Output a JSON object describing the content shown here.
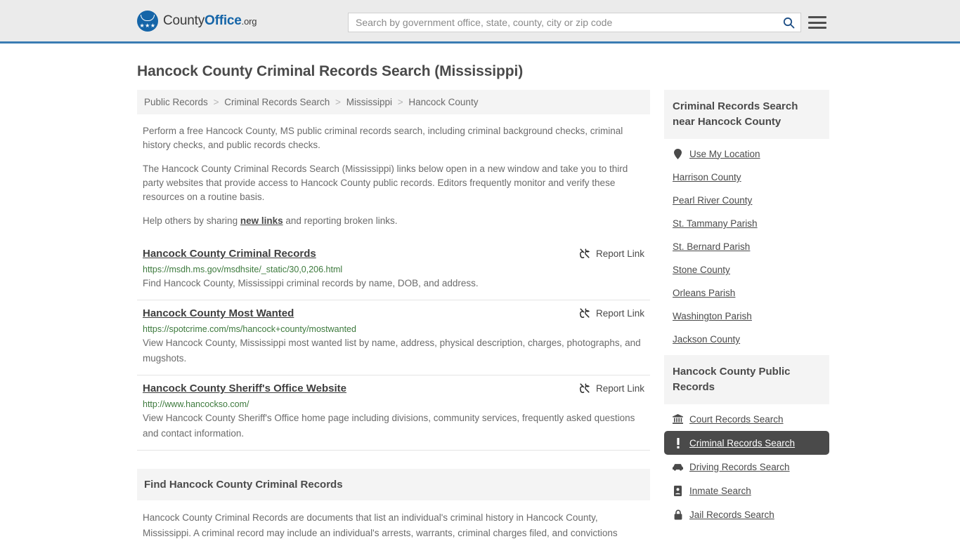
{
  "header": {
    "brand": {
      "part1": "County",
      "part2": "Office",
      "tld": ".org",
      "stars": "★★★"
    },
    "search": {
      "placeholder": "Search by government office, state, county, city or zip code",
      "value": "",
      "search_icon": "search-icon",
      "menu_icon": "hamburger-menu-icon"
    }
  },
  "page": {
    "title": "Hancock County Criminal Records Search (Mississippi)"
  },
  "breadcrumb": {
    "separator": ">",
    "items": [
      {
        "label": "Public Records"
      },
      {
        "label": "Criminal Records Search"
      },
      {
        "label": "Mississippi"
      },
      {
        "label": "Hancock County"
      }
    ]
  },
  "intro": {
    "p1": "Perform a free Hancock County, MS public criminal records search, including criminal background checks, criminal history checks, and public records checks.",
    "p2": "The Hancock County Criminal Records Search (Mississippi) links below open in a new window and take you to third party websites that provide access to Hancock County public records. Editors frequently monitor and verify these resources on a routine basis.",
    "p3_before": "Help others by sharing ",
    "p3_link": "new links",
    "p3_after": " and reporting broken links."
  },
  "report_link_label": "Report Link",
  "report_link_icon": "broken-link-icon",
  "links": [
    {
      "title": "Hancock County Criminal Records",
      "url": "https://msdh.ms.gov/msdhsite/_static/30,0,206.html",
      "description": "Find Hancock County, Mississippi criminal records by name, DOB, and address."
    },
    {
      "title": "Hancock County Most Wanted",
      "url": "https://spotcrime.com/ms/hancock+county/mostwanted",
      "description": "View Hancock County, Mississippi most wanted list by name, address, physical description, charges, photographs, and mugshots."
    },
    {
      "title": "Hancock County Sheriff's Office Website",
      "url": "http://www.hancockso.com/",
      "description": "View Hancock County Sheriff's Office home page including divisions, community services, frequently asked questions and contact information."
    }
  ],
  "find_section": {
    "heading": "Find Hancock County Criminal Records",
    "body": "Hancock County Criminal Records are documents that list an individual's criminal history in Hancock County, Mississippi. A criminal record may include an individual's arrests, warrants, criminal charges filed, and convictions"
  },
  "sidebar": {
    "nearby": {
      "heading": "Criminal Records Search near Hancock County",
      "use_my_location": {
        "label": "Use My Location",
        "icon": "map-pin-icon"
      },
      "items": [
        {
          "label": "Harrison County"
        },
        {
          "label": "Pearl River County"
        },
        {
          "label": "St. Tammany Parish"
        },
        {
          "label": "St. Bernard Parish"
        },
        {
          "label": "Stone County"
        },
        {
          "label": "Orleans Parish"
        },
        {
          "label": "Washington Parish"
        },
        {
          "label": "Jackson County"
        }
      ]
    },
    "public_records": {
      "heading": "Hancock County Public Records",
      "items": [
        {
          "label": "Court Records Search",
          "icon": "courthouse-icon",
          "active": false
        },
        {
          "label": "Criminal Records Search",
          "icon": "exclamation-icon",
          "active": true
        },
        {
          "label": "Driving Records Search",
          "icon": "car-icon",
          "active": false
        },
        {
          "label": "Inmate Search",
          "icon": "id-badge-icon",
          "active": false
        },
        {
          "label": "Jail Records Search",
          "icon": "lock-icon",
          "active": false
        }
      ]
    }
  },
  "colors": {
    "header_bg": "#ebebeb",
    "header_border": "#3b7cb3",
    "brand_blue": "#1565a8",
    "panel_bg": "#f4f4f4",
    "active_bg": "#4a4a4a",
    "url_green": "#3d7a3d",
    "text": "#6b6b6b"
  }
}
